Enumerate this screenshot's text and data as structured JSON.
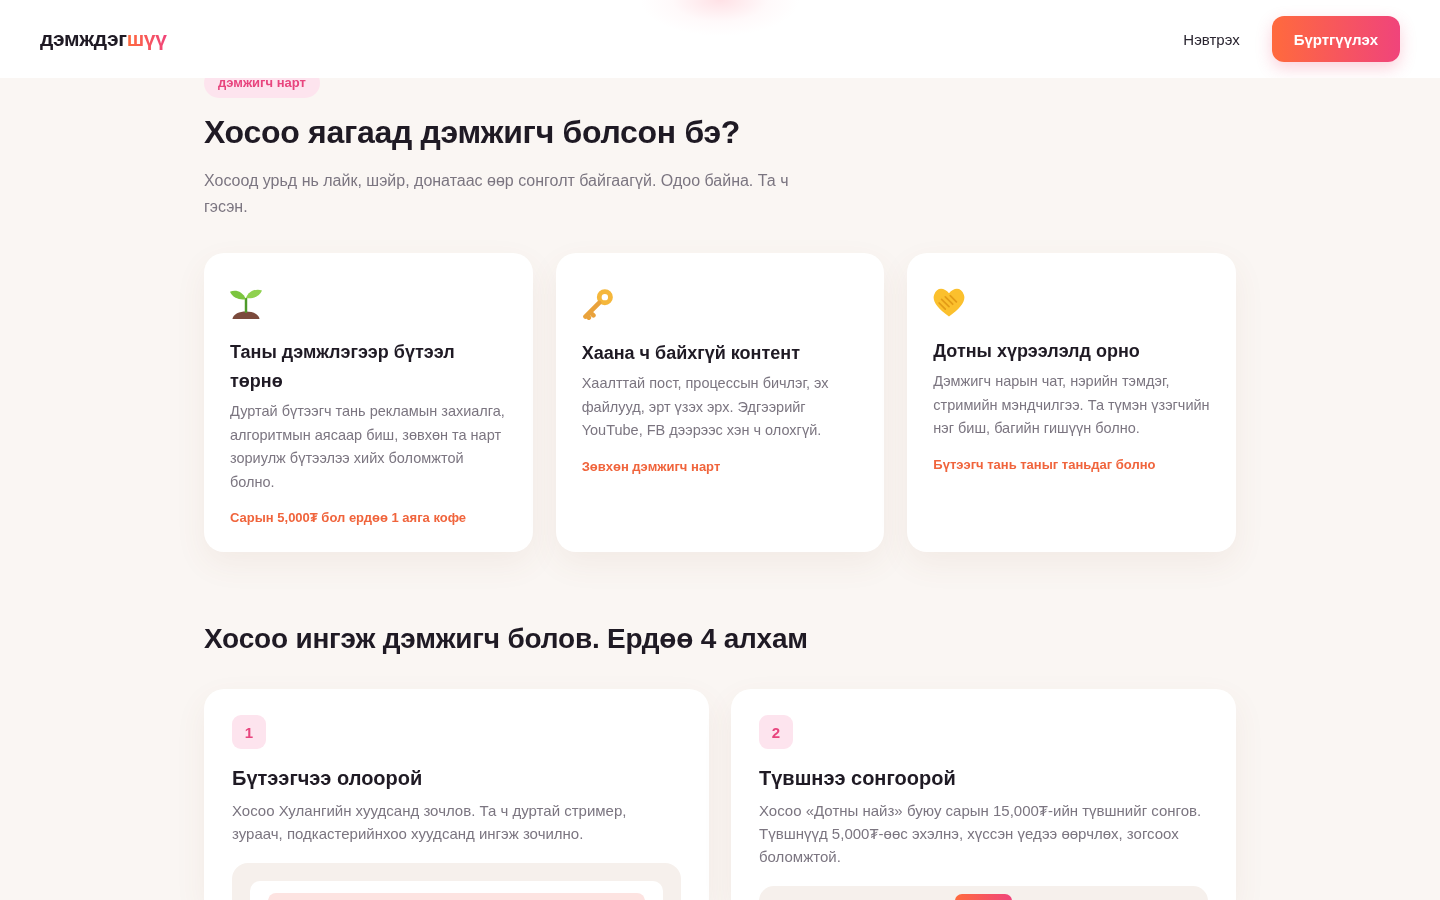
{
  "header": {
    "logo": {
      "text": "дэмждэг",
      "accent": "шүү"
    },
    "nav": [
      {
        "kind": "link",
        "label": "Нэвтрэх"
      },
      {
        "kind": "primary",
        "label": "Бүртгүүлэх"
      }
    ]
  },
  "why": {
    "tag": "дэмжигч нарт",
    "title": "Хосоо яагаад дэмжигч болсон бэ?",
    "lead": "Хосоод урьд нь лайк, шэйр, донатаас өөр сонголт байгаагүй. Одоо байна. Та ч гэсэн.",
    "cards": [
      {
        "title": "Таны дэмжлэгээр бүтээл төрнө",
        "body": "Дуртай бүтээгч тань рекламын захиалга, алгоритмын аясаар биш, зөвхөн та нарт зориулж бүтээлээ хийх боломжтой болно.",
        "note": "Сарын 5,000₮ бол ердөө 1 аяга кофе"
      },
      {
        "title": "Хаана ч байхгүй контент",
        "body": "Хаалттай пост, процессын бичлэг, эх файлууд, эрт үзэх эрх. Эдгээрийг YouTube, FB дээрээс хэн ч олохгүй.",
        "note": "Зөвхөн дэмжигч нарт"
      },
      {
        "title": "Дотны хүрээлэлд орно",
        "body": "Дэмжигч нарын чат, нэрийн тэмдэг, стримийн мэндчилгээ. Та түмэн үзэгчийн нэг биш, багийн гишүүн болно.",
        "note": "Бүтээгч тань таныг таньдаг болно"
      }
    ]
  },
  "steps": {
    "title": "Хосоо ингэж дэмжигч болов. Ердөө 4 алхам",
    "items": [
      {
        "number": "1",
        "title": "Бүтээгчээ олоорой",
        "body": "Хосоо Хулангийн хуудсанд зочлов. Та ч дуртай стример, зураач, подкастерийнхоо хуудсанд ингэж зочилно."
      },
      {
        "number": "2",
        "title": "Түвшнээ сонгоорой",
        "body": "Хосоо «Дотны найз» буюу сарын 15,000₮-ийн түвшнийг сонгов. Түвшнүүд 5,000₮-өөс эхэлнэ, хүссэн үедээ өөрчлөх, зогсоох боломжтой."
      }
    ]
  }
}
